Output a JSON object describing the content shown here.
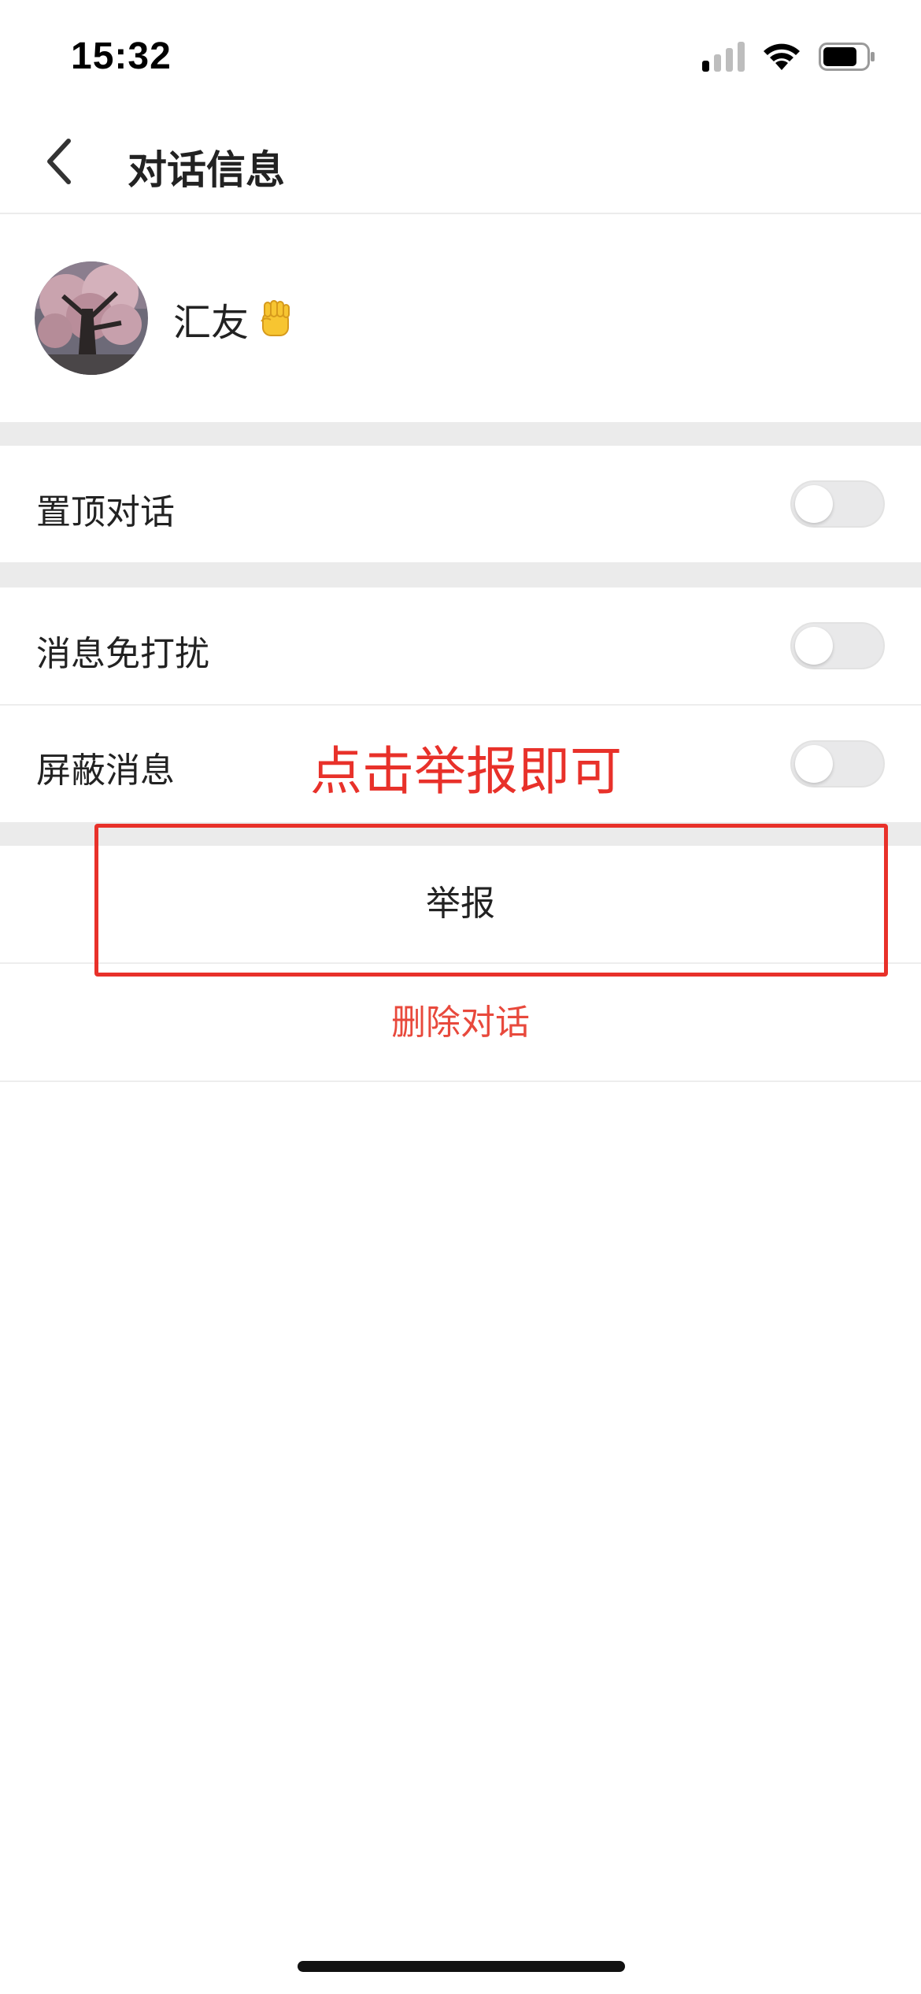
{
  "status_bar": {
    "time": "15:32",
    "signal_icon": "cellular-signal-icon",
    "wifi_icon": "wifi-icon",
    "battery_icon": "battery-icon"
  },
  "nav": {
    "back_icon": "chevron-left-icon",
    "title": "对话信息"
  },
  "profile": {
    "name": "汇友",
    "emoji_icon": "raised-fist-icon"
  },
  "settings": [
    {
      "label": "置顶对话",
      "toggle_on": false
    },
    {
      "label": "消息免打扰",
      "toggle_on": false
    },
    {
      "label": "屏蔽消息",
      "toggle_on": false
    }
  ],
  "annotation": {
    "text": "点击举报即可",
    "color": "#e8312a"
  },
  "actions": {
    "report_label": "举报",
    "delete_label": "删除对话"
  },
  "colors": {
    "section_gap": "#ebebeb",
    "delete_text": "#e8493c",
    "toggle_off": "#e9e9ea"
  }
}
